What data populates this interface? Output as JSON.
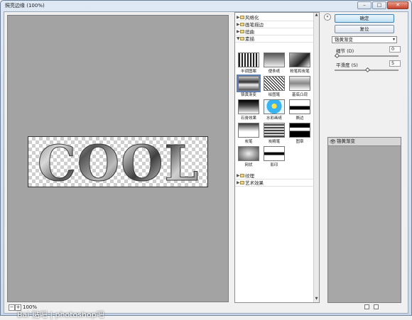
{
  "window": {
    "title": "照亮边缘 (100%)",
    "buttons": {
      "minimize": "–",
      "maximize": "□",
      "close": "✕"
    }
  },
  "preview": {
    "text": "COOL",
    "zoom": "100%",
    "zoom_minus": "−",
    "zoom_plus": "+"
  },
  "gallery": {
    "categories_top": [
      "风格化",
      "画笔描边",
      "扭曲",
      "素描"
    ],
    "open_category_index": 3,
    "thumbnails": [
      {
        "label": "半调图案"
      },
      {
        "label": "便条纸"
      },
      {
        "label": "粉笔和炭笔"
      },
      {
        "label": "铬黄渐变",
        "selected": true
      },
      {
        "label": "绘图笔"
      },
      {
        "label": "基底凸现"
      },
      {
        "label": "石膏效果"
      },
      {
        "label": "水彩画纸"
      },
      {
        "label": "撕边"
      },
      {
        "label": "炭笔"
      },
      {
        "label": "炭精笔"
      },
      {
        "label": "图章"
      },
      {
        "label": "网状"
      },
      {
        "label": "影印"
      }
    ],
    "categories_bottom": [
      "纹理",
      "艺术效果"
    ]
  },
  "panel": {
    "ok_label": "确定",
    "reset_label": "复位",
    "filter_select": "铬黄渐变",
    "params": [
      {
        "label": "细节 (D)",
        "value": "0",
        "level": 0.0
      },
      {
        "label": "平滑度 (S)",
        "value": "5",
        "level": 0.5
      }
    ],
    "layer": {
      "name": "铬黄渐变"
    }
  },
  "watermark": "Bai 贴吧 | photoshop吧"
}
